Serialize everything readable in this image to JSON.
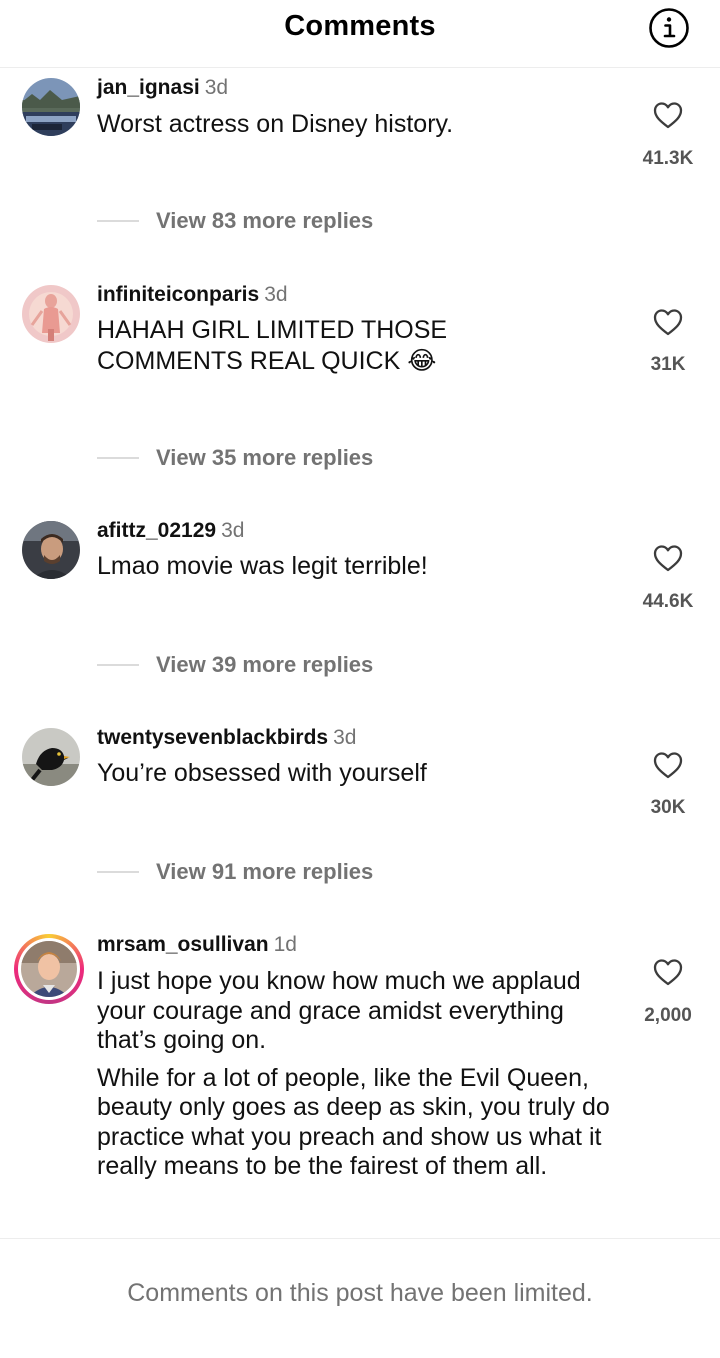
{
  "header": {
    "title": "Comments"
  },
  "comments": [
    {
      "username": "jan_ignasi",
      "time": "3d",
      "text": [
        "Worst actress on Disney history."
      ],
      "likes": "41.3K",
      "replies": "View 83 more replies",
      "avatar": "landscape-photo"
    },
    {
      "username": "infiniteiconparis",
      "time": "3d",
      "text": [
        "HAHAH GIRL LIMITED THOSE COMMENTS REAL QUICK"
      ],
      "emoji": "😂",
      "likes": "31K",
      "replies": "View 35 more replies",
      "avatar": "figure-illustration"
    },
    {
      "username": "afittz_02129",
      "time": "3d",
      "text": [
        "Lmao movie was legit terrible!"
      ],
      "likes": "44.6K",
      "replies": "View 39 more replies",
      "avatar": "man-portrait"
    },
    {
      "username": "twentysevenblackbirds",
      "time": "3d",
      "text": [
        "You’re obsessed with yourself"
      ],
      "likes": "30K",
      "replies": "View 91 more replies",
      "avatar": "blackbird-photo"
    },
    {
      "username": "mrsam_osullivan",
      "time": "1d",
      "text": [
        "I just hope you know how much we applaud your courage and grace amidst everything that’s going on.",
        "While for a lot of people, like the Evil Queen, beauty only goes as deep as skin, you truly do practice what you preach and show us what it really means to be the fairest of them all."
      ],
      "likes": "2,000",
      "avatar": "story-ring-portrait"
    }
  ],
  "footer": {
    "text": "Comments on this post have been limited."
  },
  "icons": {
    "info": "info-icon",
    "like": "heart-outline-icon"
  }
}
